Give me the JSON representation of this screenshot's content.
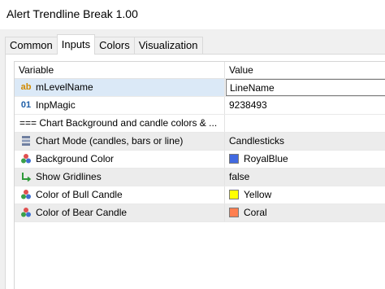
{
  "window": {
    "title": "Alert Trendline Break 1.00"
  },
  "tabs": [
    {
      "label": "Common",
      "active": false
    },
    {
      "label": "Inputs",
      "active": true
    },
    {
      "label": "Colors",
      "active": false
    },
    {
      "label": "Visualization",
      "active": false
    }
  ],
  "grid": {
    "headers": {
      "variable": "Variable",
      "value": "Value"
    },
    "rows": [
      {
        "icon": "text-ab-icon",
        "variable": "mLevelName",
        "value": "LineName"
      },
      {
        "icon": "numeric-01-icon",
        "variable": "InpMagic",
        "value": "9238493"
      },
      {
        "icon": "",
        "variable": "=== Chart Background and candle colors & ...",
        "value": ""
      },
      {
        "icon": "enum-list-icon",
        "variable": "Chart Mode (candles, bars or line)",
        "value": "Candlesticks"
      },
      {
        "icon": "color-palette-icon",
        "variable": "Background Color",
        "value": "RoyalBlue",
        "swatch": "#4169E1"
      },
      {
        "icon": "bool-arrow-icon",
        "variable": "Show Gridlines",
        "value": "false"
      },
      {
        "icon": "color-palette-icon",
        "variable": "Color of Bull Candle",
        "value": "Yellow",
        "swatch": "#FFFF00"
      },
      {
        "icon": "color-palette-icon",
        "variable": "Color of Bear Candle",
        "value": "Coral",
        "swatch": "#FF7F50"
      }
    ]
  },
  "colors": {
    "selected_row": "#dbe9f7",
    "grey_row": "#ececec"
  }
}
